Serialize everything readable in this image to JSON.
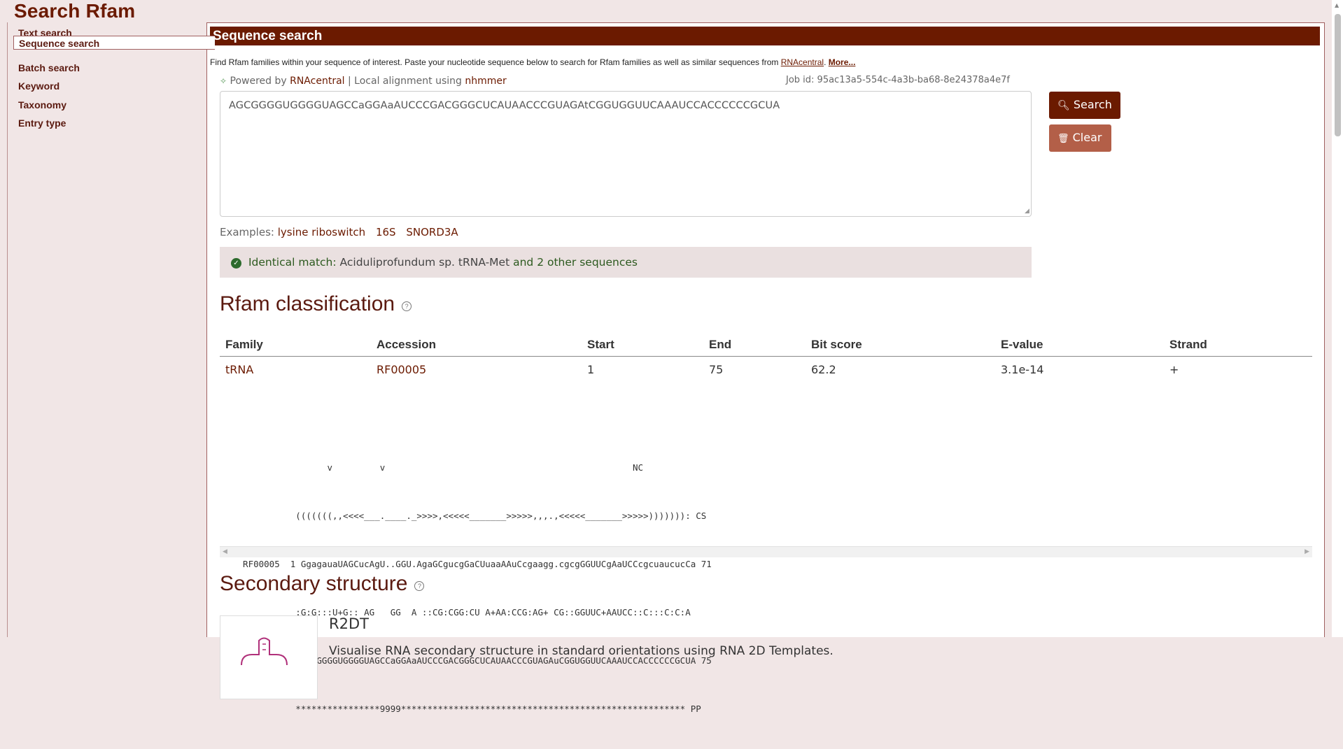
{
  "page": {
    "title": "Search Rfam"
  },
  "sidebar": {
    "items": [
      {
        "label": "Text search"
      },
      {
        "label": "Sequence search"
      },
      {
        "label": "Batch search"
      },
      {
        "label": "Keyword"
      },
      {
        "label": "Taxonomy"
      },
      {
        "label": "Entry type"
      }
    ]
  },
  "main": {
    "header": "Sequence search",
    "intro": {
      "text": "Find Rfam families within your sequence of interest. Paste your nucleotide sequence below to search for Rfam families as well as similar sequences from ",
      "link": "RNAcentral",
      "sep": ". ",
      "more": "More..."
    },
    "powered": {
      "prefix": "Powered by ",
      "rnacentral": "RNAcentral",
      "divider": " | ",
      "local": "Local alignment using ",
      "tool": "nhmmer"
    },
    "job_id": "Job id: 95ac13a5-554c-4a3b-ba68-8e24378a4e7f",
    "sequence_value": "AGCGGGGUGGGGUAGCCaGGAaAUCCCGACGGGCUCAUAACCCGUAGAtCGGUGGUUCAAAUCCACCCCCCGCUA",
    "buttons": {
      "search": "Search",
      "clear": "Clear"
    },
    "examples": {
      "label": "Examples:",
      "items": [
        "lysine riboswitch",
        "16S",
        "SNORD3A"
      ]
    },
    "match": {
      "prefix": "Identical match:",
      "value": "Aciduliprofundum sp. tRNA-Met",
      "suffix": "and 2 other sequences"
    },
    "classification": {
      "title": "Rfam classification",
      "help": "?",
      "columns": [
        "Family",
        "Accession",
        "Start",
        "End",
        "Bit score",
        "E-value",
        "Strand"
      ],
      "rows": [
        {
          "family": "tRNA",
          "accession": "RF00005",
          "start": "1",
          "end": "75",
          "bit_score": "62.2",
          "evalue": "3.1e-14",
          "strand": "+"
        }
      ],
      "alignment": [
        "                  v         v                                               NC",
        "            (((((((,,<<<<___.____._>>>>,<<<<<_______>>>>>,,,.,<<<<<_______>>>>>))))))): CS",
        "  RF00005  1 GgagauaUAGCucAgU..GGU.AgaGCgucgGaCUuaaAAuCcgaagg.cgcgGGUUCgAaUCCcgcuaucucCa 71",
        "            :G:G:::U+G:: AG   GG  A ::CG:CGG:CU A+AA:CCG:AG+ CG::GGUUC+AAUCC::C:::C:C:A",
        "    query  1 AGCGGGGUGGGGUAGCCaGGAaAUCCCGACGGGCUCAUAACCCGUAGAuCGGUGGUUCAAAUCCACCCCCCGCUA 75",
        "            ****************9999****************************************************** PP"
      ]
    },
    "secondary": {
      "title": "Secondary structure",
      "help": "?",
      "card_title": "R2DT",
      "card_desc": "Visualise RNA secondary structure in standard orientations using RNA 2D Templates."
    }
  },
  "colors": {
    "brand": "#6b1a00",
    "clear": "#b35f48",
    "sidebar_bg": "#f1e6e6"
  }
}
